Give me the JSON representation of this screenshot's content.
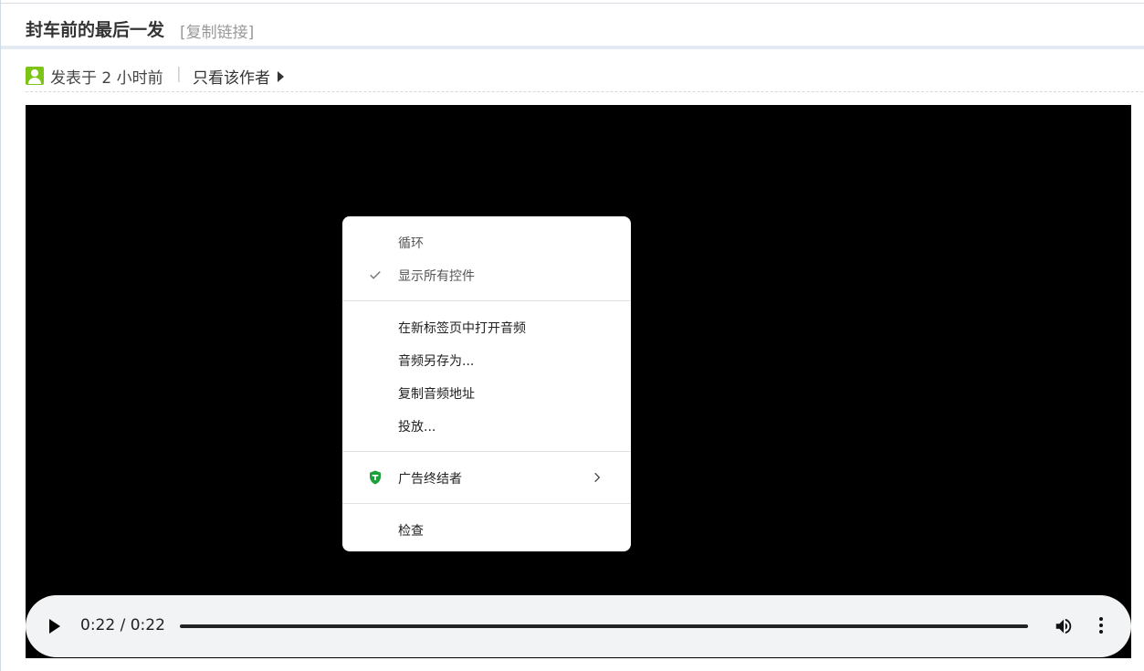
{
  "post": {
    "title": "封车前的最后一发",
    "copy_link_label": "[复制链接]",
    "posted_time": "发表于 2 小时前",
    "separator": "|",
    "only_author_label": "只看该作者"
  },
  "player": {
    "time_display": "0:22 / 0:22",
    "progress_fraction": 1.0,
    "icons": {
      "play": "play-icon",
      "volume": "volume-icon",
      "more": "more-vert-icon"
    }
  },
  "context_menu": {
    "items": [
      {
        "label": "循环",
        "checked": false
      },
      {
        "label": "显示所有控件",
        "checked": true
      },
      {
        "label": "在新标签页中打开音频"
      },
      {
        "label": "音频另存为..."
      },
      {
        "label": "复制音频地址"
      },
      {
        "label": "投放..."
      },
      {
        "label": "广告终结者",
        "icon": "adblock-shield-icon",
        "submenu": true
      },
      {
        "label": "检查"
      }
    ]
  },
  "colors": {
    "accent_green": "#7cc416",
    "shield_green": "#1aa13a",
    "video_bg": "#000000",
    "controls_bg": "#f1f3f4"
  }
}
